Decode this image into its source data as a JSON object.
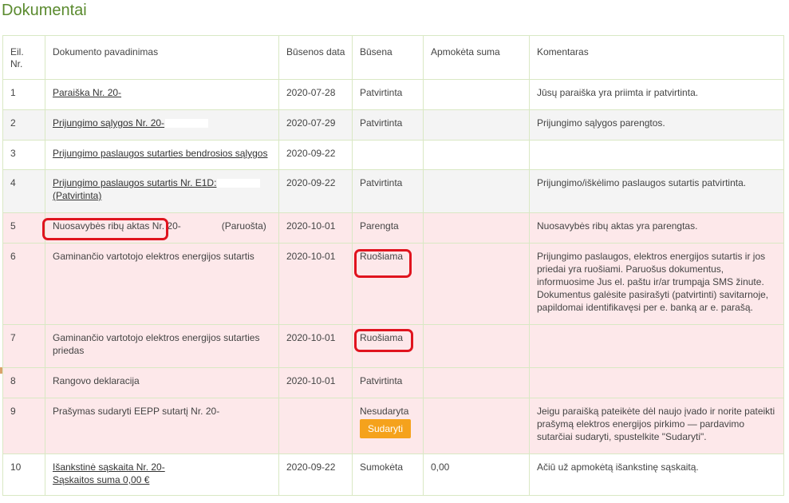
{
  "page": {
    "title": "Dokumentai"
  },
  "table": {
    "headers": {
      "num": "Eil. Nr.",
      "name": "Dokumento pavadinimas",
      "date": "Būsenos data",
      "status": "Būsena",
      "paid": "Apmokėta suma",
      "comment": "Komentaras"
    },
    "rows": [
      {
        "num": "1",
        "name": "Paraiška Nr. 20-",
        "date": "2020-07-28",
        "status": "Patvirtinta",
        "paid": "",
        "comment": "Jūsų paraiška yra priimta ir patvirtinta."
      },
      {
        "num": "2",
        "name": "Prijungimo sąlygos Nr. 20-",
        "date": "2020-07-29",
        "status": "Patvirtinta",
        "paid": "",
        "comment": "Prijungimo sąlygos parengtos."
      },
      {
        "num": "3",
        "name": "Prijungimo paslaugos sutarties bendrosios sąlygos",
        "date": "2020-09-22",
        "status": "",
        "paid": "",
        "comment": ""
      },
      {
        "num": "4",
        "name": "Prijungimo paslaugos sutartis Nr. E1D:",
        "name2": "(Patvirtinta)",
        "date": "2020-09-22",
        "status": "Patvirtinta",
        "paid": "",
        "comment": "Prijungimo/iškėlimo paslaugos sutartis patvirtinta."
      },
      {
        "num": "5",
        "name": "Nuosavybės ribų aktas Nr. 20-",
        "name_suffix": "(Paruošta)",
        "date": "2020-10-01",
        "status": "Parengta",
        "paid": "",
        "comment": "Nuosavybės ribų aktas yra parengtas."
      },
      {
        "num": "6",
        "name": "Gaminančio vartotojo elektros energijos sutartis",
        "date": "2020-10-01",
        "status": "Ruošiama",
        "paid": "",
        "comment": "Prijungimo paslaugos, elektros energijos sutartis ir jos priedai yra ruošiami. Paruošus dokumentus, informuosime Jus el. paštu ir/ar trumpąja SMS žinute. Dokumentus galėsite pasirašyti (patvirtinti) savitarnoje, papildomai identifikavęsi per e. banką ar e. parašą."
      },
      {
        "num": "7",
        "name": "Gaminančio vartotojo elektros energijos sutarties priedas",
        "date": "2020-10-01",
        "status": "Ruošiama",
        "paid": "",
        "comment": ""
      },
      {
        "num": "8",
        "name": "Rangovo deklaracija",
        "date": "2020-10-01",
        "status": "Patvirtinta",
        "paid": "",
        "comment": ""
      },
      {
        "num": "9",
        "name": "Prašymas sudaryti EEPP sutartį Nr. 20-",
        "date": "",
        "status": "Nesudaryta",
        "button": "Sudaryti",
        "paid": "",
        "comment": "Jeigu paraišką pateikėte dėl naujo įvado ir norite pateikti prašymą elektros energijos pirkimo — pardavimo sutarčiai sudaryti, spustelkite \"Sudaryti\"."
      },
      {
        "num": "10",
        "name": "Išankstinė sąskaita Nr. 20-",
        "name2": "Sąskaitos suma 0,00 €",
        "date": "2020-09-22",
        "status": "Sumokėta",
        "paid": "0,00",
        "comment": "Ačiū už apmokėtą išankstinę sąskaitą."
      }
    ]
  },
  "colors": {
    "title": "#5a8a2e",
    "border": "#d9e8c4",
    "pink_row": "#fde8ea",
    "gray_row": "#f4f4f4",
    "button": "#f5a21c",
    "annotation": "#e0141e"
  }
}
